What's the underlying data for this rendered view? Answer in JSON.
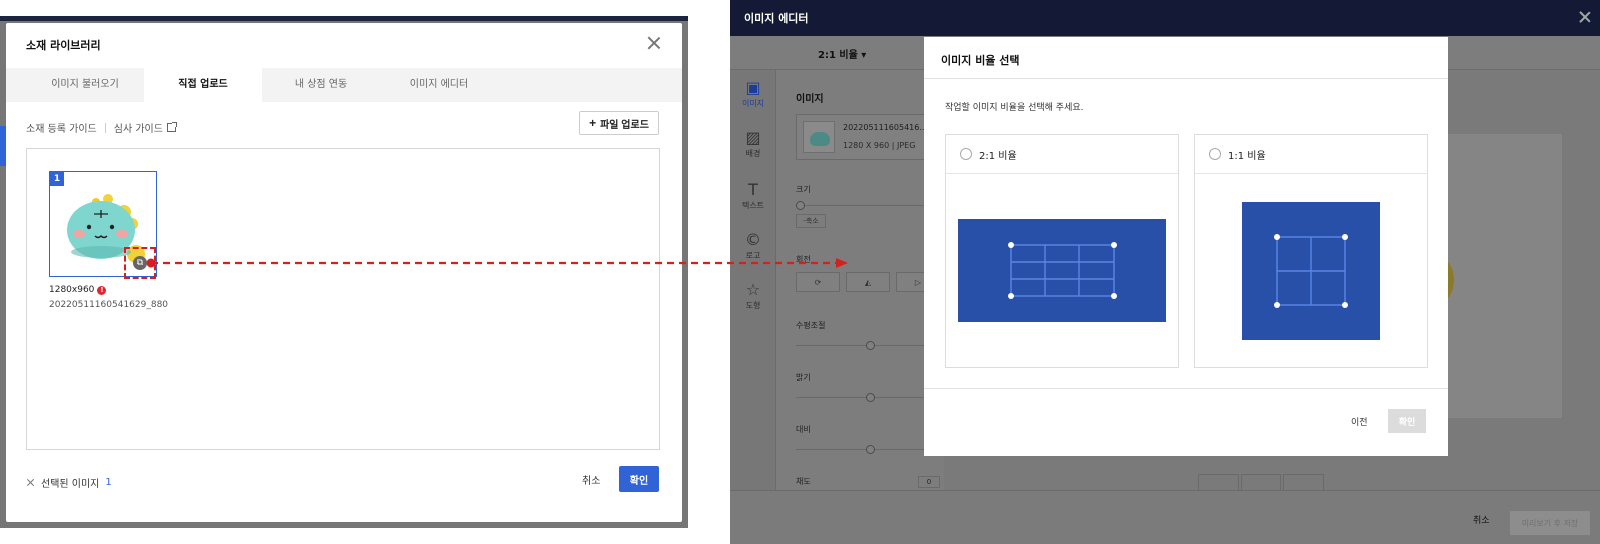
{
  "library": {
    "title": "소재 라이브러리",
    "tabs": [
      {
        "label": "이미지 불러오기",
        "active": false
      },
      {
        "label": "직접 업로드",
        "active": true
      },
      {
        "label": "내 상점 연동",
        "active": false
      },
      {
        "label": "이미지 에디터",
        "active": false
      }
    ],
    "guide_link_1": "소재 등록 가이드",
    "guide_link_2": "심사 가이드",
    "upload_button": "파일 업로드",
    "item": {
      "index": "1",
      "size": "1280x960",
      "alert": "!",
      "filename": "20220511160541629_880..."
    },
    "selected_label": "선택된 이미지",
    "selected_count": "1",
    "cancel": "취소",
    "confirm": "확인"
  },
  "editor": {
    "title": "이미지 에디터",
    "ratio_select": "2:1 비율 ▾",
    "sidebar": [
      {
        "label": "이미지",
        "icon": "image-icon",
        "active": true
      },
      {
        "label": "배경",
        "icon": "background-icon",
        "active": false
      },
      {
        "label": "텍스트",
        "icon": "text-icon",
        "active": false
      },
      {
        "label": "로고",
        "icon": "logo-icon",
        "active": false
      },
      {
        "label": "도형",
        "icon": "shape-icon",
        "active": false
      }
    ],
    "panel": {
      "heading": "이미지",
      "file_name": "202205111605416...",
      "file_meta": "1280 X 960 | JPEG",
      "size_label": "크기",
      "shrink_button": "-축소",
      "enlarge_button": "+",
      "rotate_label": "회전",
      "horizontal_label": "수평조절",
      "brightness_label": "밝기",
      "contrast_label": "대비",
      "saturation_label": "채도",
      "saturation_value": "0"
    },
    "footer_cancel": "취소",
    "footer_save": "미리보기 후 저장"
  },
  "ratio_dialog": {
    "title": "이미지 비율 선택",
    "description": "작업할 이미지 비율을 선택해 주세요.",
    "options": [
      {
        "label": "2:1 비율"
      },
      {
        "label": "1:1 비율"
      }
    ],
    "prev": "이전",
    "ok": "확인"
  },
  "colors": {
    "accent": "#2f63d6",
    "illustration": "#2850a8",
    "arrow": "#d61f1f",
    "header": "#141a36"
  }
}
